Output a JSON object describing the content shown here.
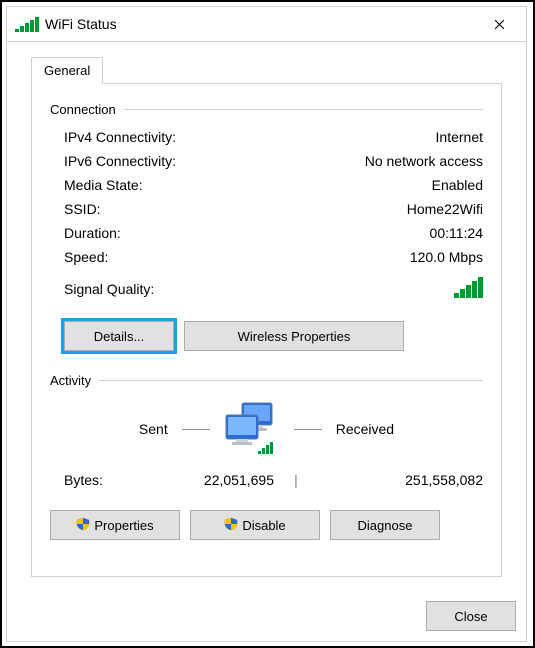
{
  "window": {
    "title": "WiFi Status"
  },
  "tabs": {
    "general": "General"
  },
  "connection": {
    "header": "Connection",
    "ipv4_label": "IPv4 Connectivity:",
    "ipv4_value": "Internet",
    "ipv6_label": "IPv6 Connectivity:",
    "ipv6_value": "No network access",
    "media_label": "Media State:",
    "media_value": "Enabled",
    "ssid_label": "SSID:",
    "ssid_value": "Home22Wifi",
    "duration_label": "Duration:",
    "duration_value": "00:11:24",
    "speed_label": "Speed:",
    "speed_value": "120.0 Mbps",
    "signal_label": "Signal Quality:"
  },
  "buttons": {
    "details": "Details...",
    "wireless_properties": "Wireless Properties",
    "properties": "Properties",
    "disable": "Disable",
    "diagnose": "Diagnose",
    "close": "Close"
  },
  "activity": {
    "header": "Activity",
    "sent_label": "Sent",
    "received_label": "Received",
    "bytes_label": "Bytes:",
    "bytes_sent": "22,051,695",
    "bytes_divider": "|",
    "bytes_received": "251,558,082"
  }
}
